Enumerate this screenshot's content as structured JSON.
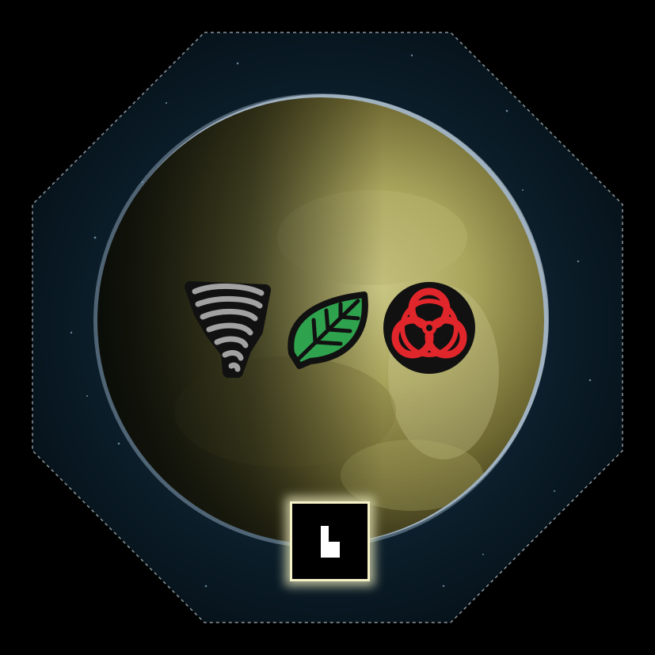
{
  "tile": {
    "kind": "planet-tile",
    "shape": "octagon",
    "colors": {
      "space": "#08141e",
      "planet": "#a9a45c",
      "atmosphere_rim": "#cfe8ff",
      "frame_dash": "#8d969c"
    }
  },
  "traits": [
    {
      "icon": "tornado-icon",
      "color": "#a2a2a2"
    },
    {
      "icon": "leaf-icon",
      "color": "#2fa24e"
    },
    {
      "icon": "biohazard-icon",
      "color": "#e0262b"
    }
  ],
  "marker": {
    "icon": "l-shaped-glyph-icon",
    "fill": "#ffffff",
    "glow": "#eeecbe"
  }
}
